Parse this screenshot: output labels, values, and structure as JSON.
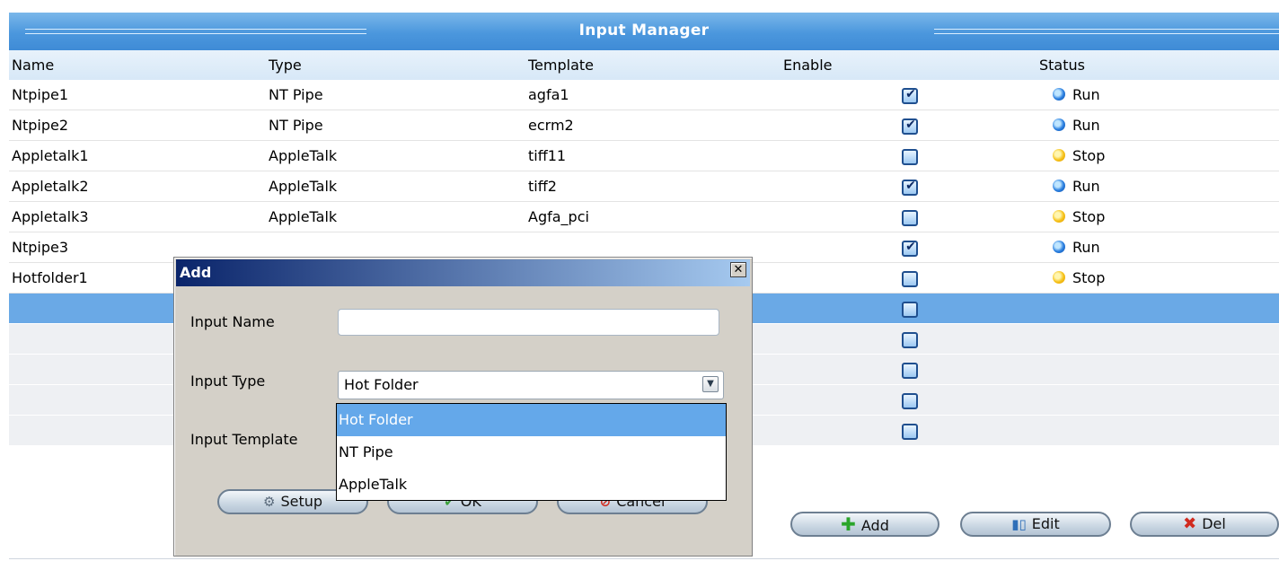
{
  "window": {
    "title": "Input Manager"
  },
  "table": {
    "columns": [
      "Name",
      "Type",
      "Template",
      "Enable",
      "Status"
    ],
    "rows": [
      {
        "name": "Ntpipe1",
        "type": "NT Pipe",
        "template": "agfa1",
        "enabled": true,
        "status": "Run"
      },
      {
        "name": "Ntpipe2",
        "type": "NT Pipe",
        "template": "ecrm2",
        "enabled": true,
        "status": "Run"
      },
      {
        "name": "Appletalk1",
        "type": "AppleTalk",
        "template": "tiff11",
        "enabled": false,
        "status": "Stop"
      },
      {
        "name": "Appletalk2",
        "type": "AppleTalk",
        "template": "tiff2",
        "enabled": true,
        "status": "Run"
      },
      {
        "name": "Appletalk3",
        "type": "AppleTalk",
        "template": "Agfa_pci",
        "enabled": false,
        "status": "Stop"
      },
      {
        "name": "Ntpipe3",
        "type": "",
        "template": "",
        "enabled": true,
        "status": "Run"
      },
      {
        "name": "Hotfolder1",
        "type": "",
        "template": "",
        "enabled": false,
        "status": "Stop"
      }
    ],
    "empty_row_count": 5,
    "check_mark": "✔"
  },
  "actions": {
    "add": "Add",
    "edit": "Edit",
    "del": "Del"
  },
  "dialog": {
    "title": "Add",
    "close": "✕",
    "input_name_label": "Input Name",
    "input_name_value": "",
    "input_type_label": "Input Type",
    "input_type_value": "Hot Folder",
    "input_template_label": "Input Template",
    "type_options": [
      "Hot Folder",
      "NT Pipe",
      "AppleTalk"
    ],
    "setup_label": "Setup",
    "ok_label": "OK",
    "cancel_label": "Cancel"
  },
  "colors": {
    "title_bar": "#4b97dd",
    "selected_row": "#6aa9e6",
    "dropdown_selected": "#64a8ea",
    "status_run": "#2a7fe0",
    "status_stop": "#f6c21a"
  },
  "icons": {
    "run": "status-run-icon",
    "stop": "status-stop-icon",
    "add": "plus-icon",
    "edit": "edit-icon",
    "del": "delete-icon",
    "setup": "gear-icon",
    "ok": "check-icon",
    "cancel": "cancel-icon"
  }
}
